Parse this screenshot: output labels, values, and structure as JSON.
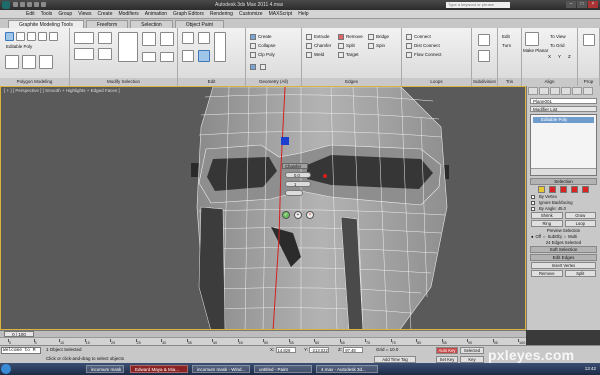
{
  "window": {
    "title": "Autodesk 3ds Max 2011    4.max",
    "search_placeholder": "Type a keyword or phrase"
  },
  "menu": [
    "Edit",
    "Tools",
    "Group",
    "Views",
    "Create",
    "Modifiers",
    "Animation",
    "Graph Editors",
    "Rendering",
    "Customize",
    "MAXScript",
    "Help"
  ],
  "ribbon_tabs": [
    "Graphite Modeling Tools",
    "Freeform",
    "Selection",
    "Object Paint"
  ],
  "ribbon": {
    "polymodeling": {
      "label": "Polygon Modeling",
      "subobj": "Editable Poly"
    },
    "modify_selection": {
      "label": "Modify Selection"
    },
    "edit": {
      "label": "Edit",
      "create": "Create",
      "collapse": "Collapse",
      "clip_poly": "Clp Poly"
    },
    "geometry": {
      "label": "Geometry (All)"
    },
    "edges": {
      "label": "Edges",
      "extrude": "Extrude",
      "chamfer": "Chamfer",
      "weld": "Weld",
      "remove": "Remove",
      "split": "Split",
      "target": "Target",
      "bridge": "Bridge",
      "spin": "Spin"
    },
    "loops": {
      "label": "Loops",
      "connect": "Connect",
      "dist_connect": "Dist Connect",
      "flow_connect": "Flow Connect"
    },
    "subdivision": {
      "label": "Subdivision"
    },
    "tris": {
      "label": "Tris",
      "edit": "Edit",
      "turn": "Turn"
    },
    "align": {
      "label": "Align",
      "make_planar": "Make Planar",
      "to_view": "To View",
      "to_grid": "To Grid",
      "x": "X",
      "y": "Y",
      "z": "Z"
    },
    "props": {
      "label": "Prop"
    }
  },
  "viewport": {
    "label": "[ + ] [ Perspective ] [ Smooth + Highlights + Edged Faces ]"
  },
  "caddy": {
    "title": "Chamfer",
    "amount": "0.0",
    "segments": "1"
  },
  "cmdpanel": {
    "object_name": "Plane001",
    "modifier_list": "Modifier List",
    "stack_item": "Editable Poly",
    "selection_rollout": "Selection",
    "by_vertex": "By Vertex",
    "ignore_backfacing": "Ignore Backfacing",
    "by_angle": "By Angle: 45.0",
    "shrink": "Shrink",
    "grow": "Grow",
    "ring": "Ring",
    "loop": "Loop",
    "preview_selection": "Preview Selection",
    "off": "Off",
    "subobj": "SubObj",
    "multi": "Multi",
    "selected_count": "24 Edges Selected",
    "soft_selection": "Soft Selection",
    "edit_edges": "Edit Edges",
    "insert_vertex": "Insert Vertex",
    "remove": "Remove",
    "split": "Split"
  },
  "timeline": {
    "slider": "0 / 100",
    "ticks": [
      "0",
      "5",
      "10",
      "15",
      "20",
      "25",
      "30",
      "35",
      "40",
      "45",
      "50",
      "55",
      "60",
      "65",
      "70",
      "75",
      "80",
      "85",
      "90",
      "95",
      "100"
    ]
  },
  "status": {
    "maxscript": "Welcome to M",
    "selected": "1 Object Selected",
    "prompt": "Click or click-and-drag to select objects",
    "x_value": "14.829",
    "y_value": "-213.022",
    "z_value": "97.48",
    "grid": "Grid = 10.0",
    "auto_key": "Auto Key",
    "selected_dd": "Selected",
    "set_key": "Set Key",
    "key_filters": "Key Filters...",
    "add_time_tag": "Add Time Tag"
  },
  "taskbar": {
    "items": [
      "incomum mask",
      "Edward Maya & Mia...",
      "incomum mask - Wind...",
      "untitled - Paint",
      "4.max - Autodesk 3d..."
    ],
    "clock": "13:42"
  },
  "watermark": "pxleyes.com",
  "colors": {
    "accent": "#3d78b8",
    "autokey": "#c94747",
    "selection_edges": "#d22020"
  }
}
